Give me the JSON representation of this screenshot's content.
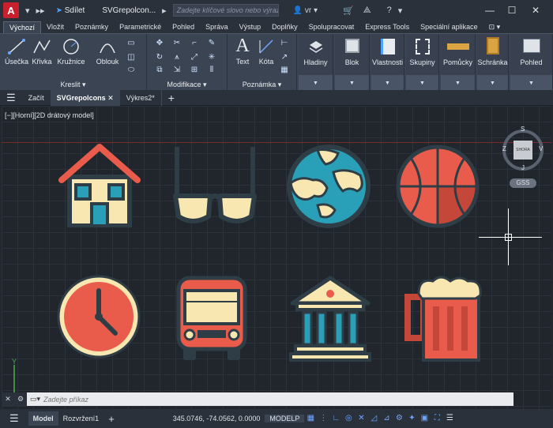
{
  "titlebar": {
    "logo": "A",
    "share": "Sdílet",
    "doc_title": "SVGrepolcon...",
    "search_placeholder": "Zadejte klíčové slovo nebo výraz.",
    "user": "vr"
  },
  "ribbon_tabs": [
    "Výchozí",
    "Vložit",
    "Poznámky",
    "Parametrické",
    "Pohled",
    "Správa",
    "Výstup",
    "Doplňky",
    "Spolupracovat",
    "Express Tools",
    "Speciální aplikace"
  ],
  "ribbon": {
    "draw": {
      "tools": [
        "Úsečka",
        "Křivka",
        "Kružnice",
        "Oblouk"
      ],
      "label": "Kreslit"
    },
    "modify": {
      "label": "Modifikace"
    },
    "annotation": {
      "tools": [
        "Text",
        "Kóta"
      ],
      "label": "Poznámka"
    },
    "panels": [
      "Hladiny",
      "Blok",
      "Vlastnosti",
      "Skupiny",
      "Pomůcky",
      "Schránka",
      "Pohled"
    ]
  },
  "file_tabs": [
    "Začít",
    "SVGrepolcons",
    "Výkres2*"
  ],
  "viewport": {
    "label": "[−][Horní][2D drátový model]",
    "viewcube": {
      "top": "S",
      "left": "Z",
      "right": "V",
      "bottom": "J",
      "face": "SHORA",
      "ucs": "GSS"
    }
  },
  "icons": [
    "house-icon",
    "glasses-icon",
    "globe-icon",
    "basketball-icon",
    "clock-icon",
    "bus-icon",
    "bank-icon",
    "beer-mug-icon"
  ],
  "command": {
    "placeholder": "Zadejte příkaz"
  },
  "status": {
    "tabs": [
      "Model",
      "Rozvržení1"
    ],
    "coords": "345.0746, -74.0562, 0.0000",
    "space": "MODELP"
  },
  "colors": {
    "accent": "#6ea6ff",
    "logo": "#c8202c",
    "icon_cream": "#f8e7b0",
    "icon_red": "#e95c4b",
    "icon_teal": "#2aa0b8",
    "icon_dark": "#2f3e46"
  }
}
